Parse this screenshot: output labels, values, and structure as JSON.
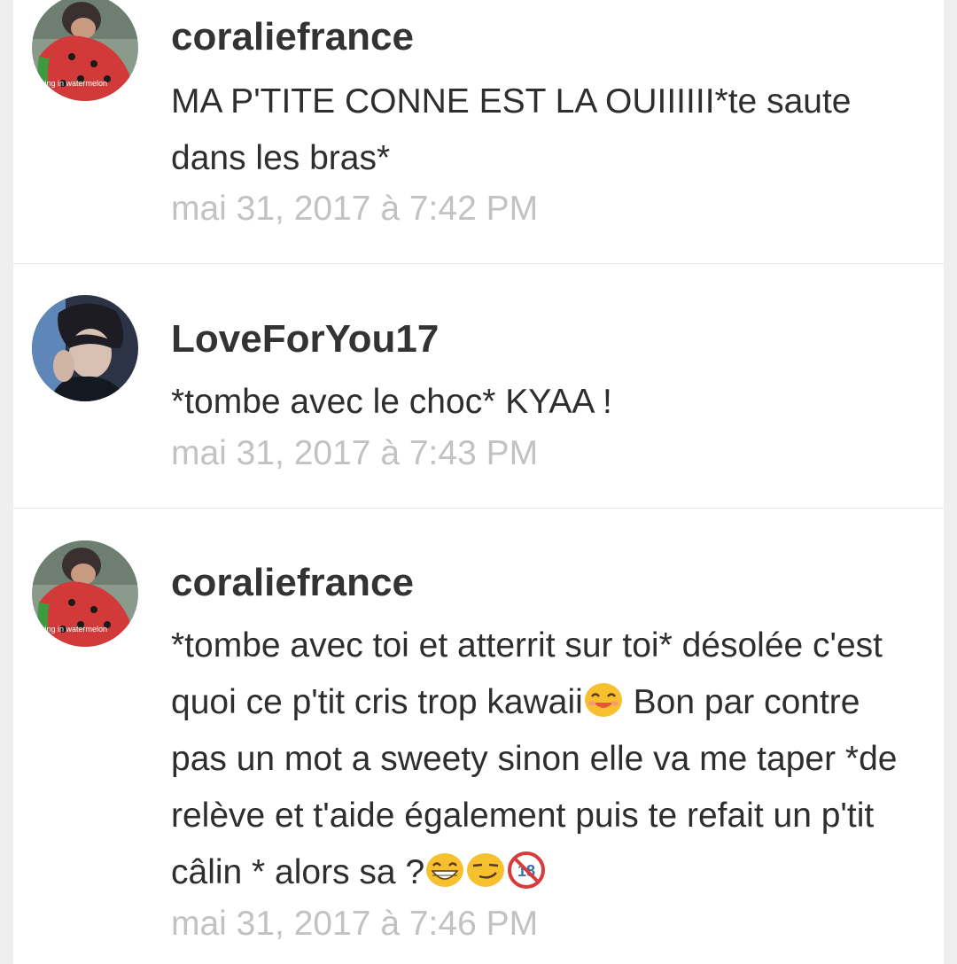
{
  "comments": [
    {
      "username": "coraliefrance",
      "avatar_caption": "living in watermelon",
      "text": "MA P'TITE CONNE EST LA OUIIIIII*te saute dans les bras*",
      "timestamp": "mai 31, 2017 à 7:42 PM"
    },
    {
      "username": "LoveForYou17",
      "text": "*tombe avec le choc* KYAA !",
      "timestamp": "mai 31, 2017 à 7:43 PM"
    },
    {
      "username": "coraliefrance",
      "avatar_caption": "living in watermelon",
      "text_part1": "*tombe avec toi et atterrit sur toi* désolée c'est quoi ce p'tit cris trop kawaii",
      "text_part2": " Bon par contre pas un mot a sweety sinon elle va me taper *de relève et t'aide également puis te refait un p'tit câlin * alors sa ?",
      "emojis": [
        "smiling-face-emoji",
        "grinning-face-emoji",
        "smirking-face-emoji",
        "no-under-18-emoji"
      ],
      "timestamp": "mai 31, 2017 à 7:46 PM"
    }
  ],
  "colors": {
    "username": "#333333",
    "text": "#2e2e2e",
    "timestamp": "#c2c2c2",
    "divider": "#e6e6e6",
    "background": "#efefef"
  }
}
